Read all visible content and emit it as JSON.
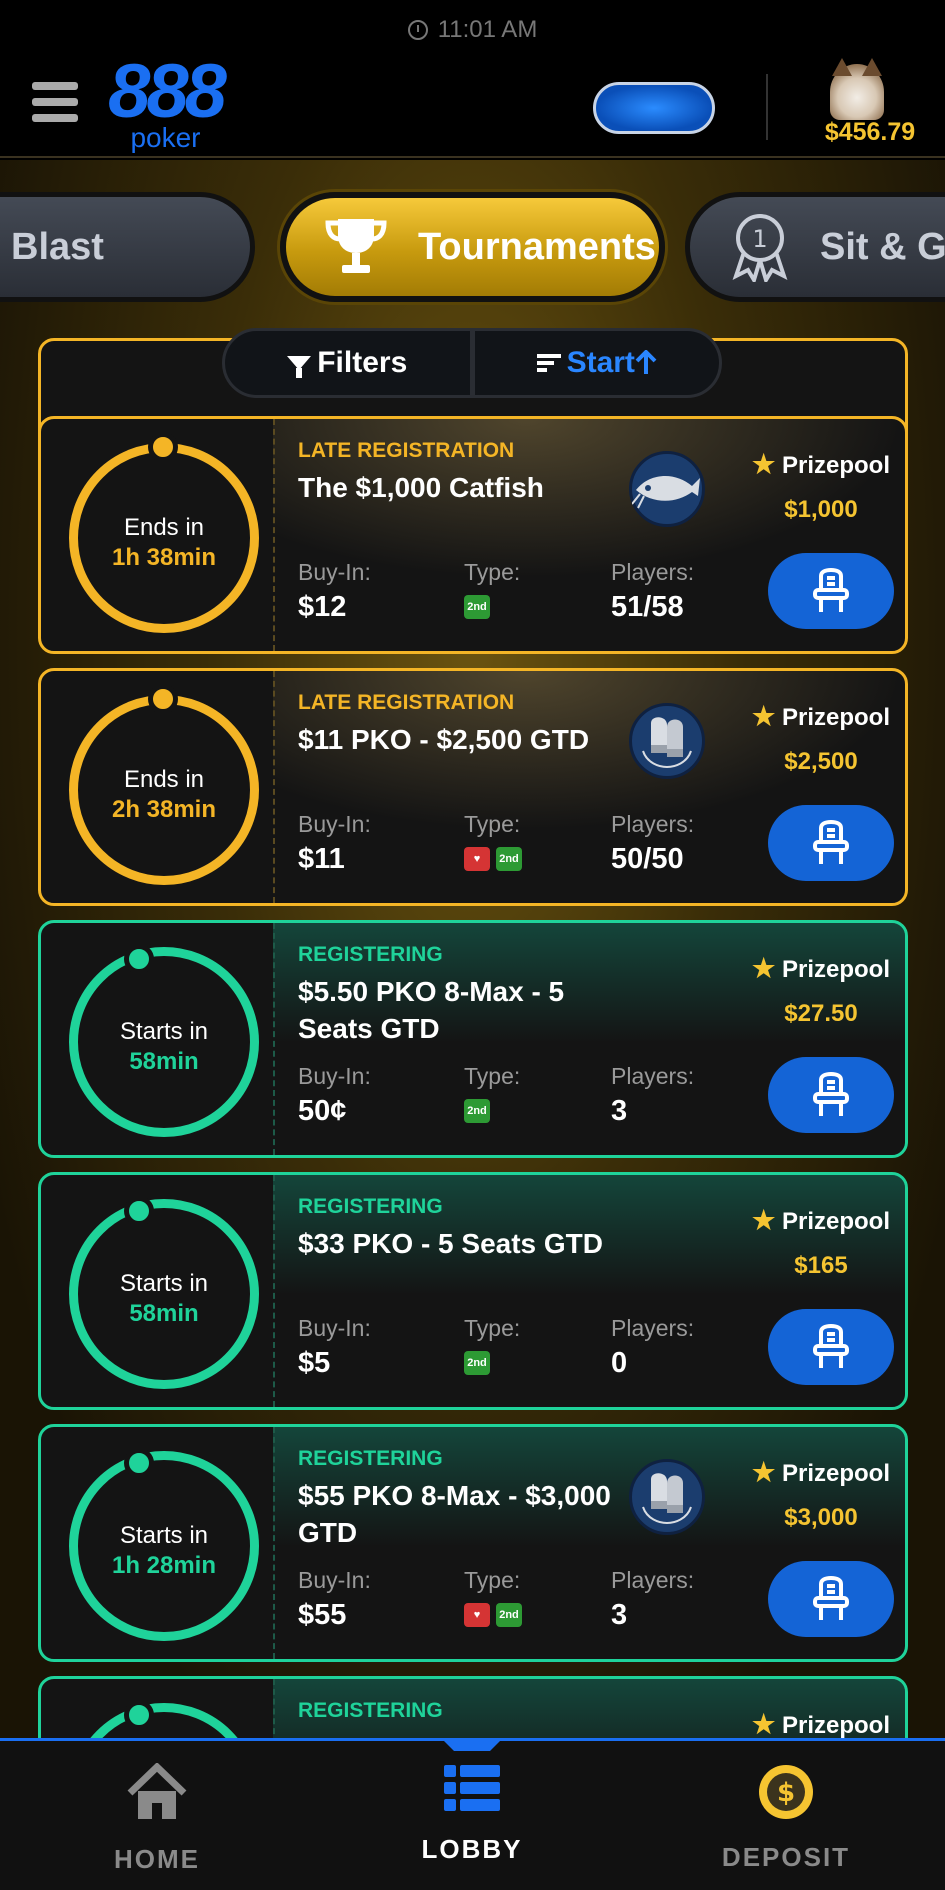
{
  "status_bar": {
    "time": "11:01 AM"
  },
  "header": {
    "logo_number": "888",
    "logo_word": "poker",
    "balance": "$456.79"
  },
  "categories": [
    {
      "label": "Blast",
      "active": false
    },
    {
      "label": "Tournaments",
      "active": true
    },
    {
      "label": "Sit & Go",
      "active": false
    }
  ],
  "filterbar": {
    "filters_label": "Filters",
    "sort_label": "Start"
  },
  "tournaments": [
    {
      "status": "LATE REGISTRATION",
      "title": "The $1,000 Catfish",
      "timer_label": "Ends in",
      "timer_value": "1h 38min",
      "buyin_label": "Buy-In:",
      "buyin": "$12",
      "type_label": "Type:",
      "types": [
        "2nd"
      ],
      "players_label": "Players:",
      "players": "51/58",
      "prize_label": "Prizepool",
      "prize": "$1,000",
      "emblem": "catfish-icon",
      "theme": "late"
    },
    {
      "status": "LATE REGISTRATION",
      "title": "$11 PKO - $2,500 GTD",
      "timer_label": "Ends in",
      "timer_value": "2h 38min",
      "buyin_label": "Buy-In:",
      "buyin": "$11",
      "type_label": "Type:",
      "types": [
        "pko",
        "2nd"
      ],
      "players_label": "Players:",
      "players": "50/50",
      "prize_label": "Prizepool",
      "prize": "$2,500",
      "emblem": "boxing-gloves-icon",
      "theme": "late"
    },
    {
      "status": "REGISTERING",
      "title": "$5.50 PKO 8-Max - 5 Seats GTD",
      "timer_label": "Starts in",
      "timer_value": "58min",
      "buyin_label": "Buy-In:",
      "buyin": "50¢",
      "type_label": "Type:",
      "types": [
        "2nd"
      ],
      "players_label": "Players:",
      "players": "3",
      "prize_label": "Prizepool",
      "prize": "$27.50",
      "emblem": "",
      "theme": "green"
    },
    {
      "status": "REGISTERING",
      "title": "$33 PKO - 5 Seats GTD",
      "timer_label": "Starts in",
      "timer_value": "58min",
      "buyin_label": "Buy-In:",
      "buyin": "$5",
      "type_label": "Type:",
      "types": [
        "2nd"
      ],
      "players_label": "Players:",
      "players": "0",
      "prize_label": "Prizepool",
      "prize": "$165",
      "emblem": "",
      "theme": "green"
    },
    {
      "status": "REGISTERING",
      "title": "$55 PKO 8-Max - $3,000 GTD",
      "timer_label": "Starts in",
      "timer_value": "1h 28min",
      "buyin_label": "Buy-In:",
      "buyin": "$55",
      "type_label": "Type:",
      "types": [
        "pko",
        "2nd"
      ],
      "players_label": "Players:",
      "players": "3",
      "prize_label": "Prizepool",
      "prize": "$3,000",
      "emblem": "boxing-gloves-icon",
      "theme": "green"
    },
    {
      "status": "REGISTERING",
      "title": "",
      "timer_label": "",
      "timer_value": "",
      "buyin_label": "",
      "buyin": "",
      "type_label": "",
      "types": [],
      "players_label": "",
      "players": "",
      "prize_label": "Prizepool",
      "prize": "",
      "emblem": "",
      "theme": "green"
    }
  ],
  "nav": [
    {
      "label": "HOME",
      "icon": "home-icon",
      "active": false
    },
    {
      "label": "LOBBY",
      "icon": "lobby-list-icon",
      "active": true
    },
    {
      "label": "DEPOSIT",
      "icon": "dollar-coin-icon",
      "active": false
    }
  ],
  "colors": {
    "accent_blue": "#1a6ff2",
    "gold": "#f4b526",
    "green": "#1fd39a"
  }
}
